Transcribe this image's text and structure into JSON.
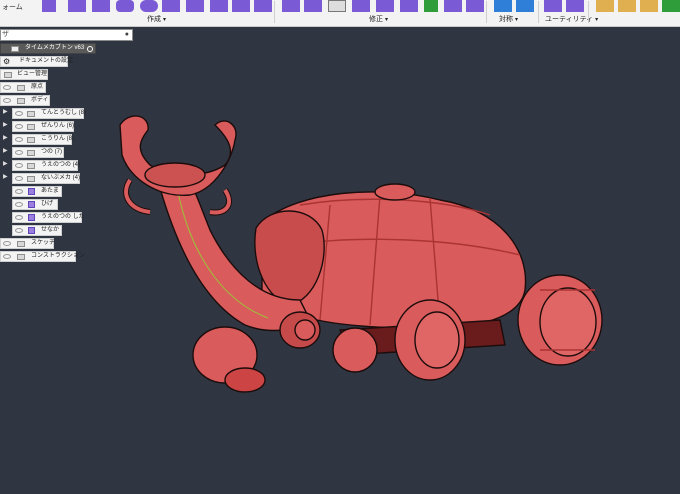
{
  "toolbar": {
    "mode_label": "ォーム",
    "groups": {
      "create": "作成",
      "modify": "修正",
      "symmetry": "対称",
      "utility": "ユーティリティ"
    },
    "caret": "▾",
    "colors": {
      "purple": "#7b5ad6",
      "green": "#2f9d3a",
      "blue": "#2f7fd8"
    }
  },
  "search": {
    "text": "ザ",
    "clear": "●"
  },
  "browser": {
    "root": {
      "label": "タイムメカブトン v63"
    },
    "items": [
      {
        "label": "ドキュメントの設定"
      },
      {
        "label": "ビュー管理"
      },
      {
        "label": "原点"
      },
      {
        "label": "ボディ"
      },
      {
        "label": "てんとうむし (8)"
      },
      {
        "label": "ぜんりん (6)"
      },
      {
        "label": "こうりん (8)"
      },
      {
        "label": "つの (7)"
      },
      {
        "label": "うえのつの (4)"
      },
      {
        "label": "ないぶメカ (4)"
      },
      {
        "label": "あたま"
      },
      {
        "label": "ひげ"
      },
      {
        "label": "うえのつの した"
      },
      {
        "label": "せなか"
      },
      {
        "label": "スケッチ"
      },
      {
        "label": "コンストラクション"
      }
    ]
  },
  "model": {
    "body_color": "#d95b5b",
    "dark_color": "#7a1e1e",
    "background": "#2f3642"
  }
}
